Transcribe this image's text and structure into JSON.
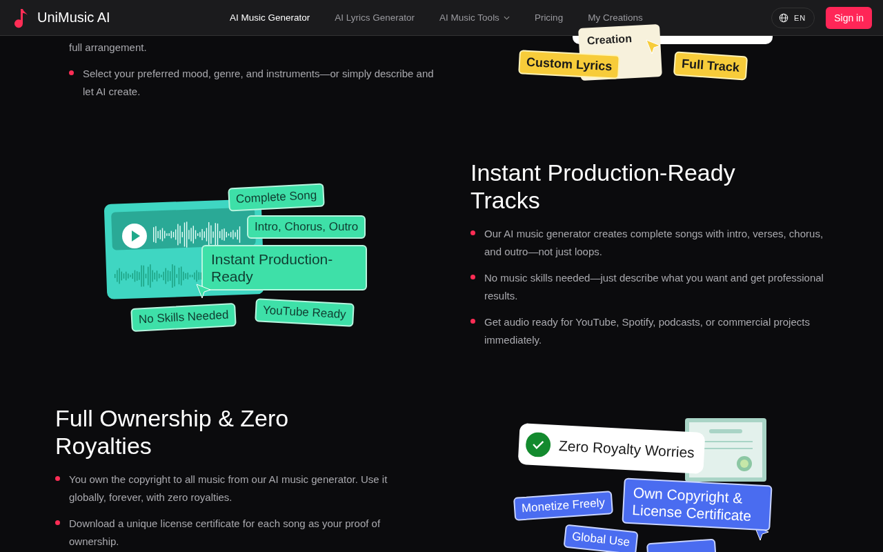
{
  "header": {
    "logo": "UniMusic AI",
    "nav": [
      {
        "label": "AI Music Generator",
        "selected": true,
        "has_dropdown": false
      },
      {
        "label": "AI Lyrics Generator",
        "selected": false,
        "has_dropdown": false
      },
      {
        "label": "AI Music Tools",
        "selected": false,
        "has_dropdown": true
      },
      {
        "label": "Pricing",
        "selected": false,
        "has_dropdown": false
      },
      {
        "label": "My Creations",
        "selected": false,
        "has_dropdown": false
      }
    ],
    "language": "EN",
    "sign_in": "Sign in"
  },
  "sections": [
    {
      "continued_text": "full arrangement.",
      "bullets": [
        "Select your preferred mood, genre, and instruments—or simply describe and let AI create."
      ],
      "illustration": {
        "kind": "creation",
        "labels": [
          "Creation",
          "Custom Lyrics",
          "Full Track"
        ]
      }
    },
    {
      "title": "Instant Production-Ready Tracks",
      "bullets": [
        "Our AI music generator creates complete songs with intro, verses, chorus, and outro—not just loops.",
        "No music skills needed—just describe what you want and get professional results.",
        "Get audio ready for YouTube, Spotify, podcasts, or commercial projects immediately."
      ],
      "illustration": {
        "kind": "tracks",
        "labels": [
          "Complete Song",
          "Intro, Chorus, Outro",
          "Instant Production-Ready",
          "No Skills Needed",
          "YouTube Ready"
        ]
      }
    },
    {
      "title": "Full Ownership & Zero Royalties",
      "bullets": [
        "You own the copyright to all music from our AI music generator. Use it globally, forever, with zero royalties.",
        "Download a unique license certificate for each song as your proof of ownership."
      ],
      "illustration": {
        "kind": "ownership",
        "labels": [
          "Zero Royalty Worries",
          "Own Copyright & License Certificate",
          "Monetize Freely",
          "Global Use"
        ]
      }
    }
  ]
}
